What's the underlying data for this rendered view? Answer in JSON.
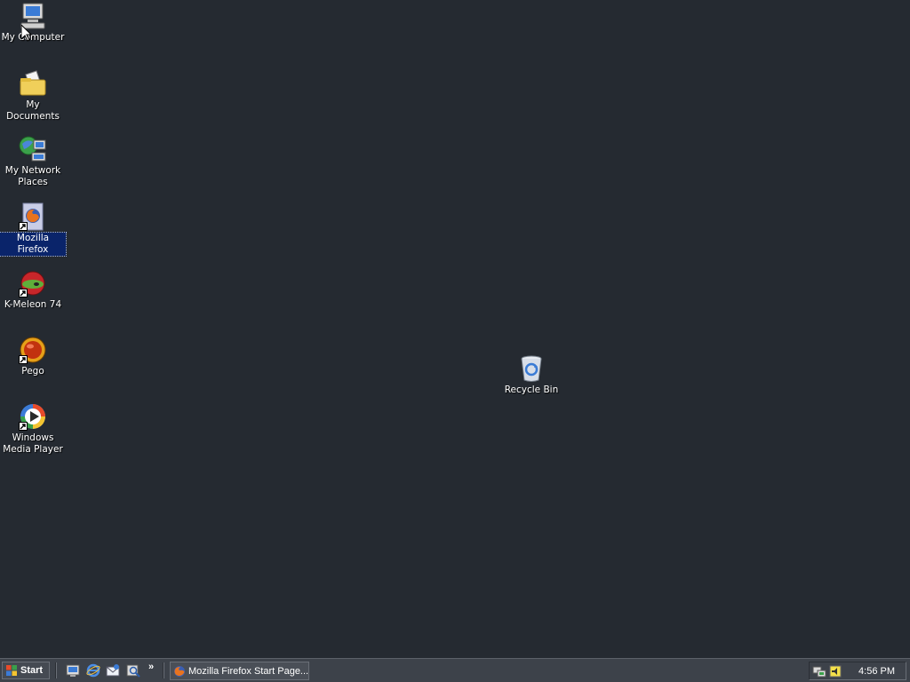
{
  "desktop": {
    "icons": [
      {
        "label": "My Computer",
        "icon": "my-computer-icon"
      },
      {
        "label": "My Documents",
        "icon": "my-documents-icon"
      },
      {
        "label": "My Network Places",
        "icon": "network-places-icon"
      },
      {
        "label": "Mozilla Firefox",
        "icon": "firefox-icon",
        "selected": true,
        "shortcut": true
      },
      {
        "label": "K-Meleon 74",
        "icon": "k-meleon-icon",
        "shortcut": true
      },
      {
        "label": "Pego",
        "icon": "pego-icon",
        "shortcut": true
      },
      {
        "label": "Windows Media Player",
        "icon": "windows-media-player-icon",
        "shortcut": true
      },
      {
        "label": "Recycle Bin",
        "icon": "recycle-bin-icon"
      }
    ],
    "background_color": "#252a31"
  },
  "taskbar": {
    "start_label": "Start",
    "quick_launch": [
      "show-desktop-icon",
      "internet-explorer-icon",
      "outlook-express-icon",
      "search-icon"
    ],
    "chevron": "»",
    "tasks": [
      {
        "label": "Mozilla Firefox Start Page...",
        "icon": "firefox-icon"
      }
    ],
    "tray_icons": [
      "network-icon",
      "volume-icon"
    ],
    "clock": "4:56 PM"
  },
  "colors": {
    "selection": "#0a246a",
    "taskbar": "#3d424a"
  }
}
